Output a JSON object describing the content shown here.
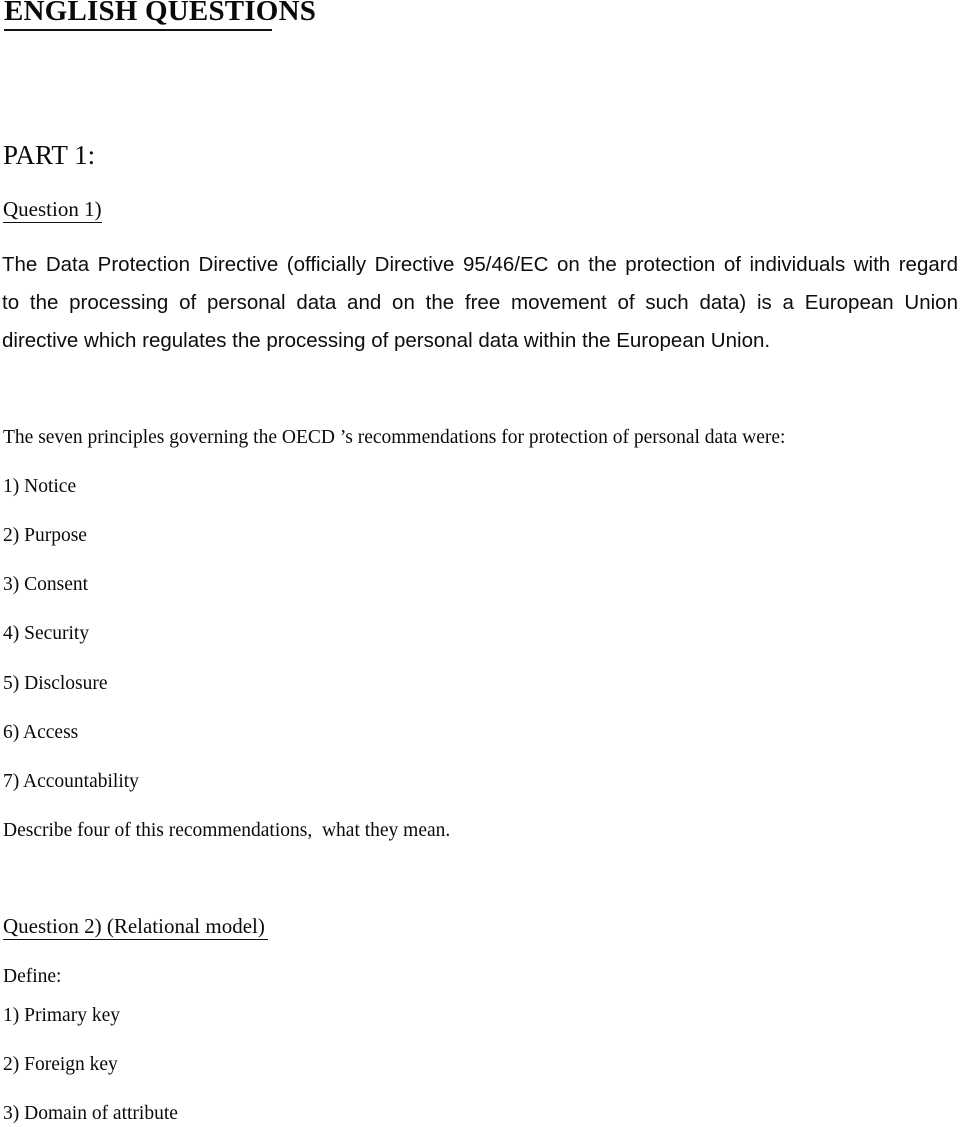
{
  "document": {
    "title": "ENGLISH QUESTIONS",
    "part_heading": "PART 1:",
    "question_1": {
      "heading": "Question 1)",
      "paragraph_lines": [
        "The Data Protection Directive (officially Directive 95/46/EC on the protection of individuals with regard",
        "to the processing of personal data and on the free movement of such data) is a European Union",
        "directive which regulates the processing of personal data within the European Union."
      ],
      "paragraph_full": "The Data Protection Directive (officially Directive 95/46/EC on the protection of individuals with regard to the processing of personal data and on the free movement of such data) is a European Union directive which regulates the processing of personal data within the European Union.",
      "oecd_intro": "The seven principles governing the OECD ’s recommendations for protection of personal data were:",
      "principles": [
        "1) Notice",
        "2) Purpose",
        "3) Consent",
        "4) Security",
        "5) Disclosure",
        "6) Access",
        "7) Accountability"
      ],
      "instruction": "Describe four of this recommendations,  what they mean."
    },
    "question_2": {
      "heading": "Question 2) (Relational model)",
      "define_label": "Define:",
      "terms": [
        "1) Primary key",
        "2) Foreign key",
        "3) Domain of attribute"
      ]
    }
  }
}
